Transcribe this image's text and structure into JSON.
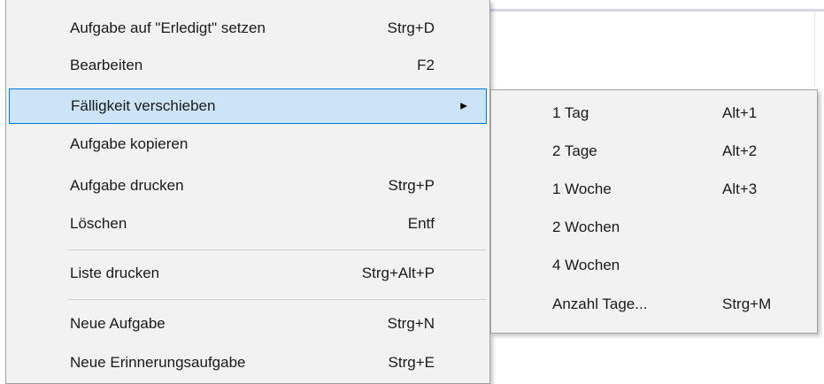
{
  "main_menu": {
    "items": [
      {
        "label": "Aufgabe auf \"Erledigt\" setzen",
        "shortcut": "Strg+D"
      },
      {
        "label": "Bearbeiten",
        "shortcut": "F2"
      },
      {
        "label": "Fälligkeit verschieben",
        "shortcut": "",
        "has_submenu": true,
        "highlighted": true
      },
      {
        "label": "Aufgabe kopieren",
        "shortcut": ""
      },
      {
        "label": "Aufgabe drucken",
        "shortcut": "Strg+P"
      },
      {
        "label": "Löschen",
        "shortcut": "Entf"
      },
      {
        "label": "Liste drucken",
        "shortcut": "Strg+Alt+P"
      },
      {
        "label": "Neue Aufgabe",
        "shortcut": "Strg+N"
      },
      {
        "label": "Neue Erinnerungsaufgabe",
        "shortcut": "Strg+E"
      }
    ]
  },
  "submenu": {
    "items": [
      {
        "label": "1 Tag",
        "shortcut": "Alt+1"
      },
      {
        "label": "2 Tage",
        "shortcut": "Alt+2"
      },
      {
        "label": "1 Woche",
        "shortcut": "Alt+3"
      },
      {
        "label": "2 Wochen",
        "shortcut": ""
      },
      {
        "label": "4 Wochen",
        "shortcut": ""
      },
      {
        "label": "Anzahl Tage...",
        "shortcut": "Strg+M"
      }
    ]
  },
  "icons": {
    "submenu_arrow": "triangle-right-icon"
  },
  "colors": {
    "menu_background": "#f2f2f2",
    "highlight_background": "#cce4f7",
    "highlight_border": "#0078d7",
    "separator": "#d0d0d0"
  }
}
